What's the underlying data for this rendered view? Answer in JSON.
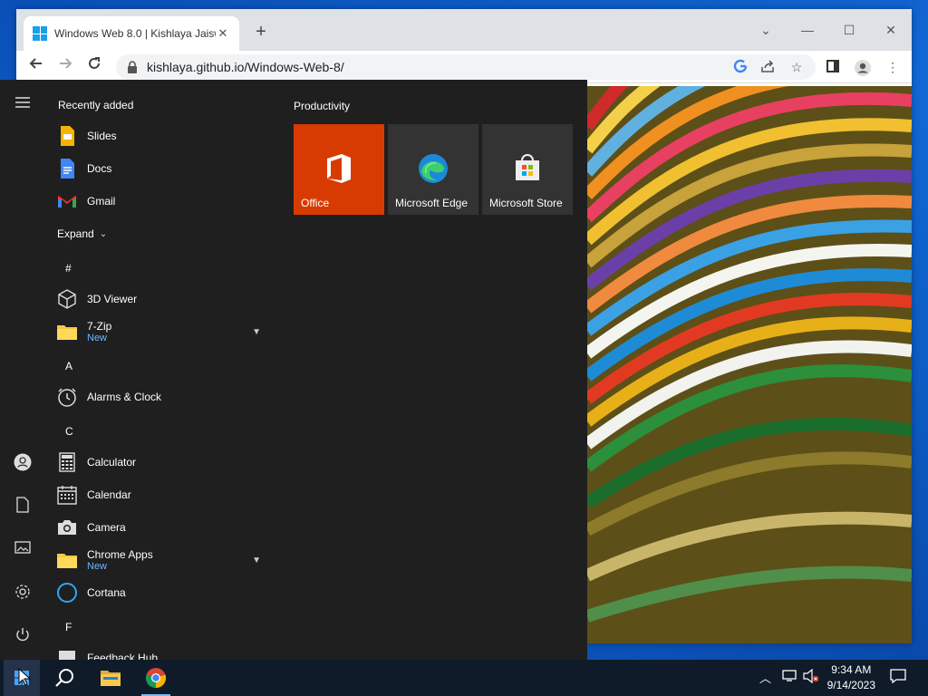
{
  "browser": {
    "tab_title": "Windows Web 8.0 | Kishlaya Jaisw",
    "url": "kishlaya.github.io/Windows-Web-8/",
    "minimize": "—",
    "maximize": "☐",
    "close": "✕"
  },
  "start": {
    "recently_added": "Recently added",
    "recent": [
      {
        "label": "Slides",
        "icon": "slides-icon"
      },
      {
        "label": "Docs",
        "icon": "docs-icon"
      },
      {
        "label": "Gmail",
        "icon": "gmail-icon"
      }
    ],
    "expand": "Expand",
    "apps": {
      "hash": "#",
      "a": "A",
      "c": "C",
      "f": "F",
      "viewer": "3D Viewer",
      "zip": "7-Zip",
      "zip_sub": "New",
      "alarms": "Alarms & Clock",
      "calculator": "Calculator",
      "calendar": "Calendar",
      "camera": "Camera",
      "chrome_apps": "Chrome Apps",
      "chrome_apps_sub": "New",
      "cortana": "Cortana",
      "feedback": "Feedback Hub"
    },
    "productivity": "Productivity",
    "tiles": [
      {
        "label": "Office",
        "color": "#d83b01"
      },
      {
        "label": "Microsoft Edge",
        "color": "#333333"
      },
      {
        "label": "Microsoft Store",
        "color": "#333333"
      }
    ]
  },
  "taskbar": {
    "time": "9:34 AM",
    "date": "9/14/2023"
  }
}
